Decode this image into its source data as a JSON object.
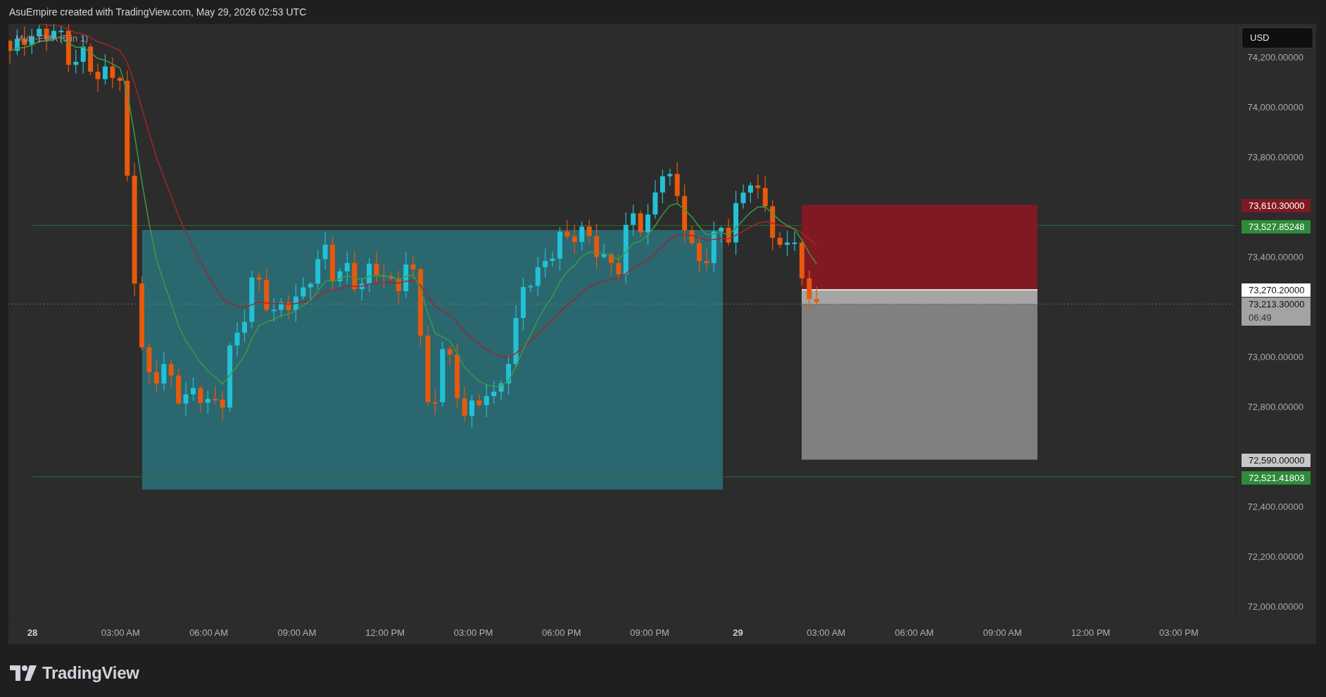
{
  "header": {
    "title": "AsuEmpire created with TradingView.com, May 29, 2026 02:53 UTC"
  },
  "legend": {
    "indicator": "Multi-EMA (5 in 1)"
  },
  "currency_button": {
    "label": "USD"
  },
  "price_axis": {
    "ticks": [
      "74,200.00000",
      "74,000.00000",
      "73,800.00000",
      "73,400.00000",
      "73,000.00000",
      "72,800.00000",
      "72,400.00000",
      "72,200.00000",
      "72,000.00000"
    ],
    "tags": [
      {
        "text": "73,610.30000",
        "color": "#801922"
      },
      {
        "text": "73,527.85248",
        "color": "#2e8b39"
      },
      {
        "text": "73,270.20000",
        "color": "#ffffff"
      },
      {
        "text": "73,213.30000",
        "subtext": "06:49",
        "color": "#a3a3a3"
      },
      {
        "text": "72,590.00000",
        "color": "#c8c8c8"
      },
      {
        "text": "72,521.41803",
        "color": "#2e8b39"
      }
    ]
  },
  "time_axis": [
    {
      "label": "28",
      "kind": "date"
    },
    {
      "label": "03:00 AM",
      "kind": "time"
    },
    {
      "label": "06:00 AM",
      "kind": "time"
    },
    {
      "label": "09:00 AM",
      "kind": "time"
    },
    {
      "label": "12:00 PM",
      "kind": "time"
    },
    {
      "label": "03:00 PM",
      "kind": "time"
    },
    {
      "label": "06:00 PM",
      "kind": "time"
    },
    {
      "label": "09:00 PM",
      "kind": "time"
    },
    {
      "label": "29",
      "kind": "date"
    },
    {
      "label": "03:00 AM",
      "kind": "time"
    },
    {
      "label": "06:00 AM",
      "kind": "time"
    },
    {
      "label": "09:00 AM",
      "kind": "time"
    },
    {
      "label": "12:00 PM",
      "kind": "time"
    },
    {
      "label": "03:00 PM",
      "kind": "time"
    }
  ],
  "footer": {
    "logo": "TradingView"
  }
}
